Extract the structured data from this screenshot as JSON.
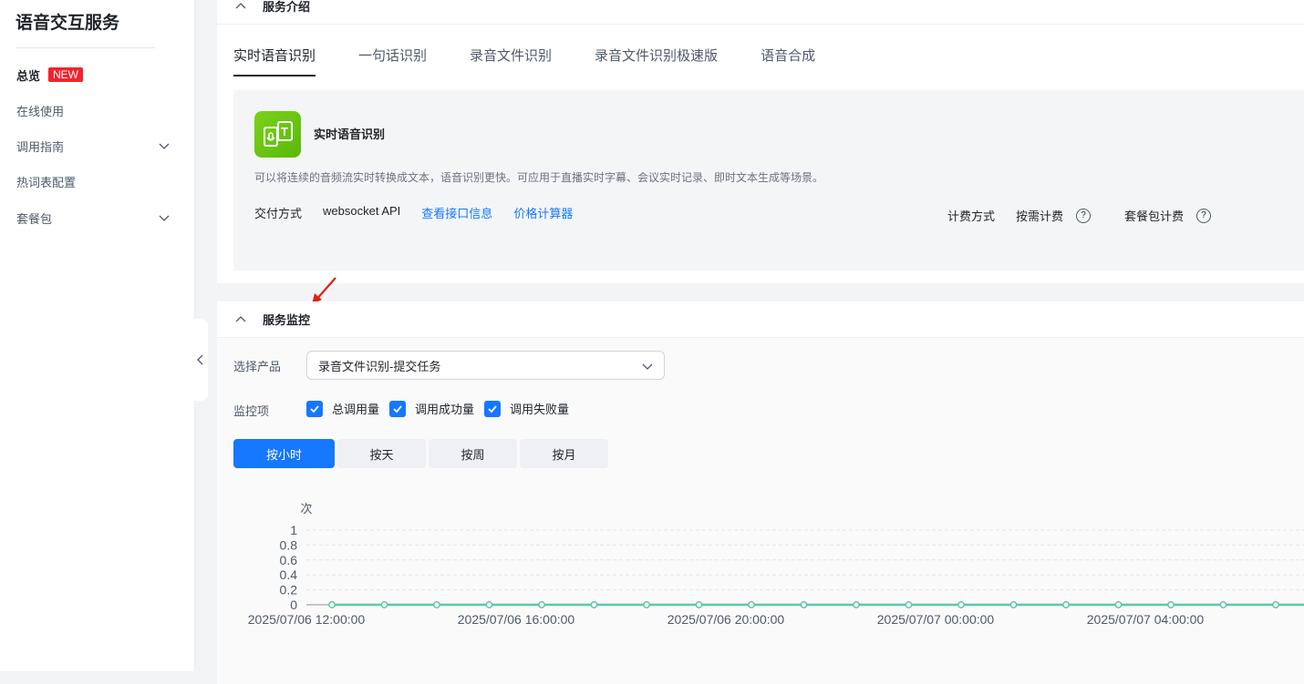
{
  "sidebar": {
    "title": "语音交互服务",
    "items": [
      {
        "label": "总览",
        "badge": "NEW"
      },
      {
        "label": "在线使用"
      },
      {
        "label": "调用指南"
      },
      {
        "label": "热词表配置"
      },
      {
        "label": "套餐包"
      }
    ]
  },
  "intro": {
    "title": "服务介绍",
    "tabs": [
      "实时语音识别",
      "一句话识别",
      "录音文件识别",
      "录音文件识别极速版",
      "语音合成"
    ],
    "card": {
      "name": "实时语音识别",
      "description": "可以将连续的音频流实时转换成文本，语音识别更快。可应用于直播实时字幕、会议实时记录、即时文本生成等场景。",
      "delivery_label": "交付方式",
      "delivery_value": "websocket API",
      "link_api": "查看接口信息",
      "link_price": "价格计算器",
      "billing_label": "计费方式",
      "billing_options": [
        "按需计费",
        "套餐包计费"
      ]
    }
  },
  "monitor": {
    "title": "服务监控",
    "product_label": "选择产品",
    "product_value": "录音文件识别-提交任务",
    "items_label": "监控项",
    "checkboxes": [
      "总调用量",
      "调用成功量",
      "调用失败量"
    ],
    "granularity": [
      "按小时",
      "按天",
      "按周",
      "按月"
    ],
    "active_granularity": "按小时"
  },
  "colors": {
    "accent": "#1677ff",
    "series": "#5cc7a6",
    "badge": "#f5222d"
  },
  "chart_data": {
    "type": "line",
    "ylabel": "次",
    "ylim": [
      0,
      1
    ],
    "yticks": [
      "1",
      "0.8",
      "0.6",
      "0.4",
      "0.2",
      "0"
    ],
    "xtick_labels": [
      "2025/07/06 12:00:00",
      "2025/07/06 16:00:00",
      "2025/07/06 20:00:00",
      "2025/07/07 00:00:00",
      "2025/07/07 04:00:00"
    ],
    "x": [
      "2025/07/06 12:00",
      "2025/07/06 13:00",
      "2025/07/06 14:00",
      "2025/07/06 15:00",
      "2025/07/06 16:00",
      "2025/07/06 17:00",
      "2025/07/06 18:00",
      "2025/07/06 19:00",
      "2025/07/06 20:00",
      "2025/07/06 21:00",
      "2025/07/06 22:00",
      "2025/07/06 23:00",
      "2025/07/07 00:00",
      "2025/07/07 01:00",
      "2025/07/07 02:00",
      "2025/07/07 03:00",
      "2025/07/07 04:00",
      "2025/07/07 05:00",
      "2025/07/07 06:00"
    ],
    "values": [
      0,
      0,
      0,
      0,
      0,
      0,
      0,
      0,
      0,
      0,
      0,
      0,
      0,
      0,
      0,
      0,
      0,
      0,
      0
    ],
    "grid": true
  }
}
